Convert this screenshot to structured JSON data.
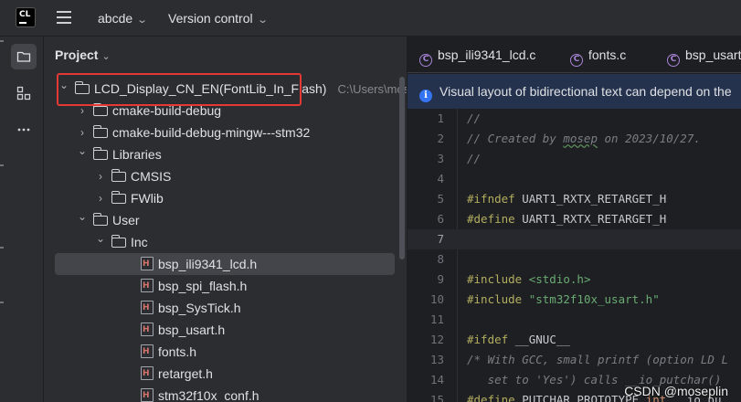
{
  "titlebar": {
    "logo": "CL",
    "project_name": "abcde",
    "vcs_label": "Version control"
  },
  "toolstrip": {
    "items": [
      {
        "icon": "folder-icon",
        "active": true
      },
      {
        "icon": "structure-icon",
        "active": false
      },
      {
        "icon": "more-icon",
        "active": false
      }
    ]
  },
  "project_panel": {
    "title": "Project",
    "tree": [
      {
        "label": "LCD_Display_CN_EN(FontLib_In_Flash)",
        "path": "C:\\Users\\mosep",
        "type": "folder",
        "level": 0,
        "expanded": true
      },
      {
        "label": "cmake-build-debug",
        "type": "folder",
        "level": 1,
        "expanded": false
      },
      {
        "label": "cmake-build-debug-mingw---stm32",
        "type": "folder",
        "level": 1,
        "expanded": false
      },
      {
        "label": "Libraries",
        "type": "folder",
        "level": 1,
        "expanded": true
      },
      {
        "label": "CMSIS",
        "type": "folder",
        "level": 2,
        "expanded": false
      },
      {
        "label": "FWlib",
        "type": "folder",
        "level": 2,
        "expanded": false
      },
      {
        "label": "User",
        "type": "folder",
        "level": 1,
        "expanded": true
      },
      {
        "label": "Inc",
        "type": "folder",
        "level": 2,
        "expanded": true
      },
      {
        "label": "bsp_ili9341_lcd.h",
        "type": "header",
        "level": 3,
        "selected": true
      },
      {
        "label": "bsp_spi_flash.h",
        "type": "header",
        "level": 3
      },
      {
        "label": "bsp_SysTick.h",
        "type": "header",
        "level": 3
      },
      {
        "label": "bsp_usart.h",
        "type": "header",
        "level": 3
      },
      {
        "label": "fonts.h",
        "type": "header",
        "level": 3
      },
      {
        "label": "retarget.h",
        "type": "header",
        "level": 3
      },
      {
        "label": "stm32f10x_conf.h",
        "type": "header",
        "level": 3
      }
    ]
  },
  "editor": {
    "tabs": [
      {
        "label": "bsp_ili9341_lcd.c",
        "icon": "c-file-icon"
      },
      {
        "label": "fonts.c",
        "icon": "c-file-icon"
      },
      {
        "label": "bsp_usart",
        "icon": "c-file-icon"
      }
    ],
    "banner": "Visual layout of bidirectional text can depend on the",
    "current_line": 7,
    "lines": [
      {
        "n": "1",
        "parts": [
          {
            "c": "cm",
            "t": "//"
          }
        ]
      },
      {
        "n": "2",
        "parts": [
          {
            "c": "cm",
            "t": "// Created by "
          },
          {
            "c": "cm und",
            "t": "mosep"
          },
          {
            "c": "cm",
            "t": " on 2023/10/27."
          }
        ]
      },
      {
        "n": "3",
        "parts": [
          {
            "c": "cm",
            "t": "//"
          }
        ]
      },
      {
        "n": "4",
        "parts": []
      },
      {
        "n": "5",
        "parts": [
          {
            "c": "pp",
            "t": "#ifndef "
          },
          {
            "c": "mac",
            "t": "UART1_RXTX_RETARGET_H"
          }
        ]
      },
      {
        "n": "6",
        "parts": [
          {
            "c": "pp",
            "t": "#define "
          },
          {
            "c": "mac",
            "t": "UART1_RXTX_RETARGET_H"
          }
        ]
      },
      {
        "n": "7",
        "parts": []
      },
      {
        "n": "8",
        "parts": []
      },
      {
        "n": "9",
        "parts": [
          {
            "c": "pp",
            "t": "#include "
          },
          {
            "c": "str",
            "t": "<stdio.h>"
          }
        ]
      },
      {
        "n": "10",
        "parts": [
          {
            "c": "pp",
            "t": "#include "
          },
          {
            "c": "str",
            "t": "\"stm32f10x_usart.h\""
          }
        ]
      },
      {
        "n": "11",
        "parts": []
      },
      {
        "n": "12",
        "parts": [
          {
            "c": "pp",
            "t": "#ifdef "
          },
          {
            "c": "mac",
            "t": "__GNUC__"
          }
        ]
      },
      {
        "n": "13",
        "parts": [
          {
            "c": "cm",
            "t": "/* With GCC, small printf (option LD L"
          }
        ]
      },
      {
        "n": "14",
        "parts": [
          {
            "c": "cm",
            "t": "   set to 'Yes') calls __io_putchar()"
          }
        ]
      },
      {
        "n": "15",
        "parts": [
          {
            "c": "pp",
            "t": "#define "
          },
          {
            "c": "mac",
            "t": "PUTCHAR_PROTOTYPE "
          },
          {
            "c": "kw",
            "t": "int"
          },
          {
            "c": "mac",
            "t": " __io_pu"
          }
        ]
      }
    ]
  },
  "watermark": "CSDN @moseplin"
}
